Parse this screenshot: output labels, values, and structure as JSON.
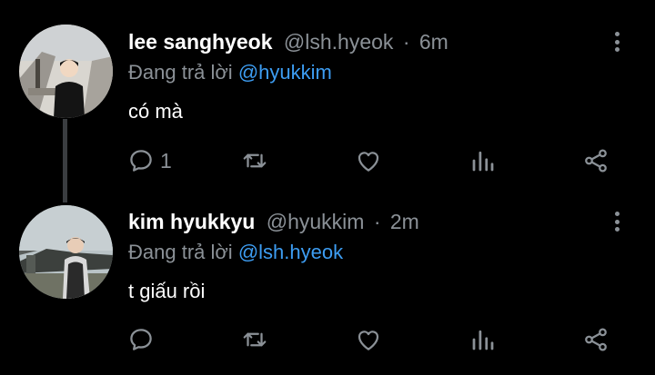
{
  "tweets": [
    {
      "name": "lee sanghyeok",
      "handle": "@lsh.hyeok",
      "time": "6m",
      "reply_prefix": "Đang trả lời",
      "reply_to": "@hyukkim",
      "text": "có mà",
      "reply_count": "1"
    },
    {
      "name": "kim hyukkyu",
      "handle": "@hyukkim",
      "time": "2m",
      "reply_prefix": "Đang trả lời",
      "reply_to": "@lsh.hyeok",
      "text": "t giấu rồi",
      "reply_count": ""
    }
  ],
  "separator": "·",
  "icons": [
    "comment-icon",
    "retweet-icon",
    "heart-icon",
    "stats-icon",
    "share-icon",
    "more-options-icon"
  ],
  "colors": {
    "background": "#000000",
    "link": "#3d9df2",
    "muted": "#8b9197",
    "text": "#ffffff"
  }
}
